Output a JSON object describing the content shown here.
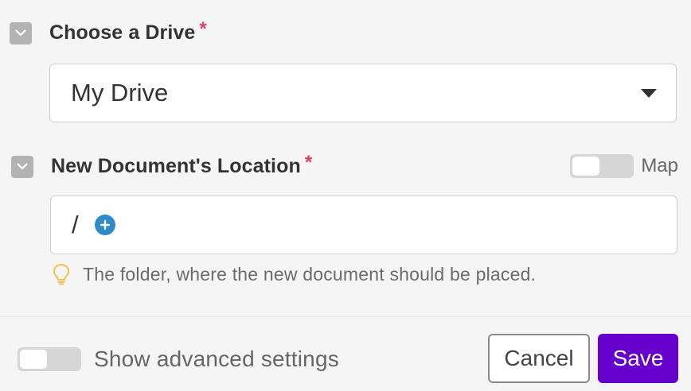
{
  "drive_field": {
    "label": "Choose a Drive",
    "required_mark": "*",
    "selected_value": "My Drive",
    "collapse_icon": "chevron-down-icon",
    "dropdown_icon": "caret-down-icon"
  },
  "location_field": {
    "label": "New Document's Location",
    "required_mark": "*",
    "map_toggle": {
      "label": "Map",
      "on": false
    },
    "path_value": "/",
    "add_icon": "plus-circle-icon",
    "collapse_icon": "chevron-down-icon",
    "hint_icon": "lightbulb-icon",
    "hint_text": "The folder, where the new document should be placed."
  },
  "footer": {
    "advanced_toggle": {
      "label": "Show advanced settings",
      "on": false
    },
    "cancel_label": "Cancel",
    "save_label": "Save"
  },
  "colors": {
    "background": "#f5f5f5",
    "required": "#e0405e",
    "primary": "#6600cc",
    "add_button": "#2e8bc9",
    "hint_bulb": "#f2c14e"
  }
}
